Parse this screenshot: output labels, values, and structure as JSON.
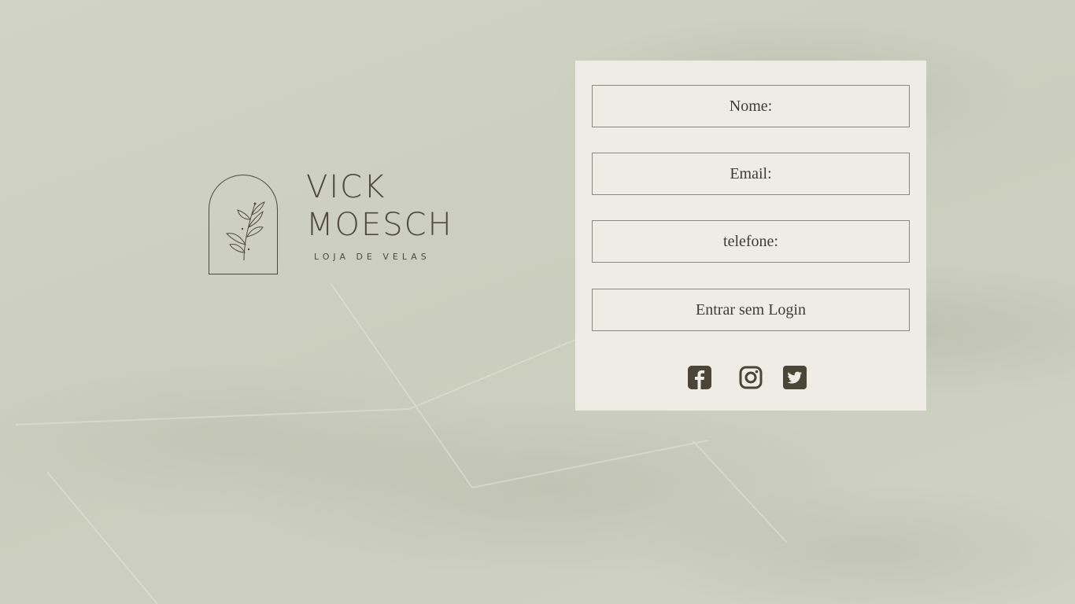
{
  "brand": {
    "name_line1": "VICK",
    "name_line2": "MOESCH",
    "tagline": "LOJA DE VELAS"
  },
  "form": {
    "name_placeholder": "Nome:",
    "email_placeholder": "Email:",
    "phone_placeholder": "telefone:",
    "submit_label": "Entrar sem Login"
  },
  "socials": [
    {
      "icon": "facebook-icon"
    },
    {
      "icon": "instagram-icon"
    },
    {
      "icon": "twitter-icon"
    }
  ],
  "colors": {
    "background": "#cfd1c2",
    "card": "#efebe5",
    "text": "#3f3c33",
    "icon": "#4a4536"
  }
}
